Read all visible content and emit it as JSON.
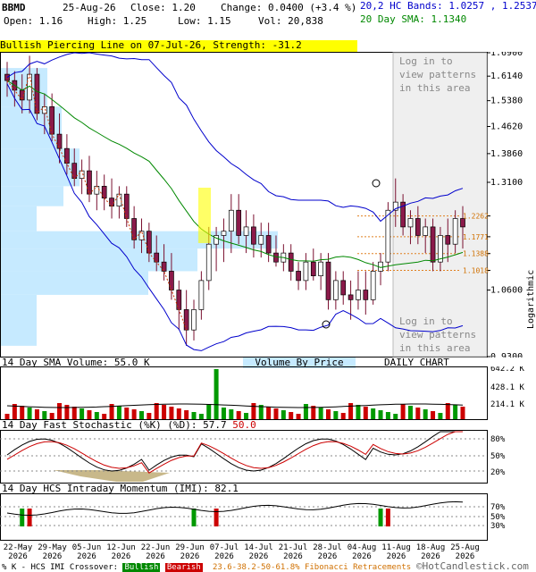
{
  "header": {
    "symbol": "BBMD",
    "date": "25-Aug-26",
    "close": "Close: 1.20",
    "change": "Change: 0.0400 (+3.4 %)",
    "open": "Open: 1.16",
    "high": "High: 1.25",
    "low": "Low: 1.15",
    "vol": "Vol: 20,838",
    "bands": "20,2 HC Bands: 1.0257 , 1.2537",
    "sma": "20 Day SMA: 1.1340"
  },
  "banner": "Bullish Piercing Line on 07-Jul-26, Strength: -31.2",
  "login_text": [
    "Log in to",
    "view patterns",
    "in this area"
  ],
  "volume_panel": {
    "title": "14 Day SMA Volume: 55.0 K",
    "vbp_label": "Volume By Price",
    "chart_label": "DAILY CHART",
    "scale_labels": [
      "642.2 K",
      "428.1 K",
      "214.1 K"
    ]
  },
  "stoch_panel": {
    "title": "14 Day Fast Stochastic (%K) (%D): 57.7",
    "title_d": "50.0",
    "scale_labels": [
      "80%",
      "50%",
      "20%"
    ]
  },
  "imi_panel": {
    "title": "14 Day HCS Intraday Momentum (IMI): 82.1",
    "scale_labels": [
      "70%",
      "50%",
      "30%"
    ]
  },
  "x_axis": {
    "labels": [
      [
        "22-May",
        "2026"
      ],
      [
        "29-May",
        "2026"
      ],
      [
        "05-Jun",
        "2026"
      ],
      [
        "12-Jun",
        "2026"
      ],
      [
        "22-Jun",
        "2026"
      ],
      [
        "29-Jun",
        "2026"
      ],
      [
        "07-Jul",
        "2026"
      ],
      [
        "14-Jul",
        "2026"
      ],
      [
        "21-Jul",
        "2026"
      ],
      [
        "28-Jul",
        "2026"
      ],
      [
        "04-Aug",
        "2026"
      ],
      [
        "11-Aug",
        "2026"
      ],
      [
        "18-Aug",
        "2026"
      ],
      [
        "25-Aug",
        "2026"
      ]
    ]
  },
  "footer": {
    "left": "% K - HCS IMI Crossover:",
    "bullish": "Bullish",
    "bearish": "Bearish",
    "fib": "23.6-38.2-50-61.8% Fibonacci Retracements",
    "brand": "©HotCandlestick.com"
  },
  "chart_data": {
    "type": "candlestick",
    "scale": "logarithmic",
    "scale_label": "Logarithmic",
    "ylim": [
      0.93,
      1.69
    ],
    "y_ticks": [
      1.69,
      1.614,
      1.538,
      1.462,
      1.386,
      1.31,
      1.2262,
      1.1771,
      1.1388,
      1.1018,
      1.06,
      0.93
    ],
    "y_tick_labels": [
      "1.6900",
      "1.6140",
      "1.5380",
      "1.4620",
      "1.3860",
      "1.3100",
      "1.2262",
      "1.1771",
      "1.1388",
      "1.1018",
      "1.0600",
      "0.9300"
    ],
    "fib_levels": [
      1.2262,
      1.1771,
      1.1388,
      1.1018
    ],
    "candles": [
      [
        1.62,
        1.66,
        1.55,
        1.6
      ],
      [
        1.6,
        1.63,
        1.52,
        1.57
      ],
      [
        1.57,
        1.62,
        1.5,
        1.54
      ],
      [
        1.54,
        1.68,
        1.5,
        1.62
      ],
      [
        1.62,
        1.64,
        1.48,
        1.5
      ],
      [
        1.5,
        1.56,
        1.44,
        1.52
      ],
      [
        1.52,
        1.56,
        1.42,
        1.44
      ],
      [
        1.44,
        1.5,
        1.36,
        1.4
      ],
      [
        1.4,
        1.44,
        1.33,
        1.36
      ],
      [
        1.36,
        1.4,
        1.3,
        1.32
      ],
      [
        1.32,
        1.37,
        1.28,
        1.34
      ],
      [
        1.34,
        1.38,
        1.26,
        1.28
      ],
      [
        1.28,
        1.34,
        1.24,
        1.3
      ],
      [
        1.3,
        1.33,
        1.24,
        1.27
      ],
      [
        1.27,
        1.32,
        1.22,
        1.25
      ],
      [
        1.25,
        1.3,
        1.22,
        1.28
      ],
      [
        1.28,
        1.3,
        1.2,
        1.22
      ],
      [
        1.22,
        1.25,
        1.15,
        1.17
      ],
      [
        1.17,
        1.22,
        1.14,
        1.19
      ],
      [
        1.19,
        1.21,
        1.12,
        1.14
      ],
      [
        1.14,
        1.18,
        1.1,
        1.12
      ],
      [
        1.12,
        1.16,
        1.08,
        1.1
      ],
      [
        1.1,
        1.14,
        1.04,
        1.06
      ],
      [
        1.06,
        1.08,
        0.98,
        1.02
      ],
      [
        1.02,
        1.06,
        0.95,
        0.98
      ],
      [
        0.98,
        1.04,
        0.96,
        1.02
      ],
      [
        1.02,
        1.1,
        1.0,
        1.08
      ],
      [
        1.08,
        1.2,
        1.06,
        1.16
      ],
      [
        1.16,
        1.2,
        1.1,
        1.18
      ],
      [
        1.18,
        1.22,
        1.12,
        1.19
      ],
      [
        1.19,
        1.28,
        1.14,
        1.24
      ],
      [
        1.24,
        1.28,
        1.16,
        1.18
      ],
      [
        1.18,
        1.24,
        1.14,
        1.2
      ],
      [
        1.2,
        1.23,
        1.13,
        1.16
      ],
      [
        1.16,
        1.21,
        1.13,
        1.18
      ],
      [
        1.18,
        1.21,
        1.12,
        1.14
      ],
      [
        1.14,
        1.18,
        1.11,
        1.12
      ],
      [
        1.12,
        1.16,
        1.1,
        1.14
      ],
      [
        1.14,
        1.16,
        1.08,
        1.1
      ],
      [
        1.1,
        1.12,
        1.06,
        1.08
      ],
      [
        1.08,
        1.14,
        1.06,
        1.12
      ],
      [
        1.12,
        1.15,
        1.08,
        1.09
      ],
      [
        1.09,
        1.14,
        1.06,
        1.12
      ],
      [
        1.12,
        1.14,
        1.02,
        1.04
      ],
      [
        1.04,
        1.1,
        1.02,
        1.08
      ],
      [
        1.08,
        1.1,
        1.03,
        1.05
      ],
      [
        1.05,
        1.08,
        1.0,
        1.04
      ],
      [
        1.04,
        1.1,
        1.02,
        1.06
      ],
      [
        1.06,
        1.1,
        1.01,
        1.04
      ],
      [
        1.04,
        1.12,
        1.03,
        1.1
      ],
      [
        1.1,
        1.14,
        1.07,
        1.12
      ],
      [
        1.12,
        1.26,
        1.1,
        1.24
      ],
      [
        1.24,
        1.32,
        1.2,
        1.26
      ],
      [
        1.26,
        1.28,
        1.18,
        1.2
      ],
      [
        1.2,
        1.24,
        1.16,
        1.22
      ],
      [
        1.22,
        1.25,
        1.16,
        1.18
      ],
      [
        1.18,
        1.22,
        1.14,
        1.2
      ],
      [
        1.2,
        1.22,
        1.1,
        1.12
      ],
      [
        1.12,
        1.2,
        1.1,
        1.18
      ],
      [
        1.18,
        1.22,
        1.12,
        1.16
      ],
      [
        1.16,
        1.24,
        1.14,
        1.22
      ],
      [
        1.22,
        1.25,
        1.15,
        1.2
      ]
    ]
  }
}
